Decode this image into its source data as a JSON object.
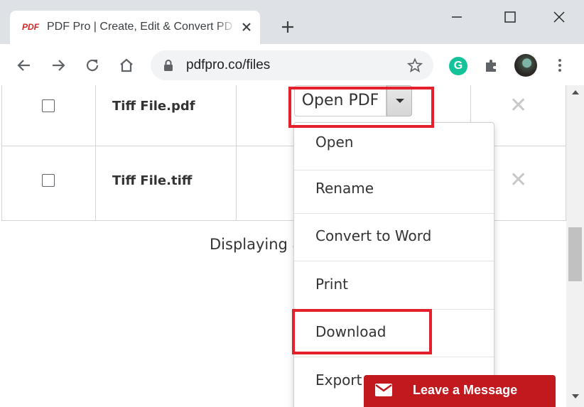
{
  "browser": {
    "tab": {
      "favicon_text": "PDF",
      "title": "PDF Pro | Create, Edit & Convert PDF"
    },
    "url": "pdfpro.co/files",
    "icons": {
      "back": "back-arrow-icon",
      "forward": "forward-arrow-icon",
      "reload": "reload-icon",
      "home": "home-icon",
      "lock": "lock-icon",
      "bookmark": "star-icon",
      "grammarly": "grammarly-icon",
      "extensions": "puzzle-icon",
      "menu": "kebab-menu-icon"
    },
    "grammarly_letter": "G"
  },
  "files": {
    "rows": [
      {
        "name": "Tiff File.pdf"
      },
      {
        "name": "Tiff File.tiff"
      }
    ],
    "delete_glyph": "✕",
    "action_button": "Open PDF",
    "footer_text": "Displaying a"
  },
  "dropdown": {
    "items": [
      "Open",
      "Rename",
      "Convert to Word",
      "Print",
      "Download",
      "Export"
    ]
  },
  "chat": {
    "label": "Leave a Message"
  },
  "colors": {
    "highlight": "#e3202b",
    "chat_background": "#c2191f",
    "grammarly": "#15c39a"
  }
}
